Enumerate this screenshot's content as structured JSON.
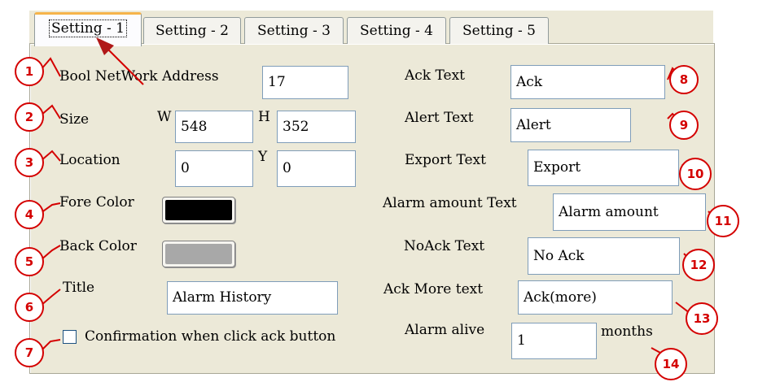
{
  "tabs": [
    "Setting - 1",
    "Setting - 2",
    "Setting - 3",
    "Setting - 4",
    "Setting - 5"
  ],
  "left": {
    "bool_network_address_label": "Bool NetWork Address",
    "bool_network_address_value": "17",
    "size_label": "Size",
    "size_w_label": "W",
    "size_w_value": "548",
    "size_h_label": "H",
    "size_h_value": "352",
    "location_label": "Location",
    "location_x_value": "0",
    "location_y_label": "Y",
    "location_y_value": "0",
    "fore_color_label": "Fore Color",
    "fore_color": "#000000",
    "back_color_label": "Back Color",
    "back_color": "#a8a8a8",
    "title_label": "Title",
    "title_value": "Alarm History",
    "confirmation_label": "Confirmation when click ack button",
    "confirmation_checked": false
  },
  "right": {
    "ack_text_label": "Ack Text",
    "ack_text_value": "Ack",
    "alert_text_label": "Alert Text",
    "alert_text_value": "Alert",
    "export_text_label": "Export Text",
    "export_text_value": "Export",
    "alarm_amount_label": "Alarm amount Text",
    "alarm_amount_value": "Alarm amount",
    "noack_text_label": "NoAck Text",
    "noack_text_value": "No Ack",
    "ack_more_label": "Ack More text",
    "ack_more_value": "Ack(more)",
    "alarm_alive_label": "Alarm alive",
    "alarm_alive_value": "1",
    "alarm_alive_unit": "months"
  },
  "badges": [
    "1",
    "2",
    "3",
    "4",
    "5",
    "6",
    "7",
    "8",
    "9",
    "10",
    "11",
    "12",
    "13",
    "14"
  ],
  "colors": {
    "annotation": "#d40000",
    "panel": "#ece9d8",
    "active_tab_accent": "#f6b44a"
  }
}
